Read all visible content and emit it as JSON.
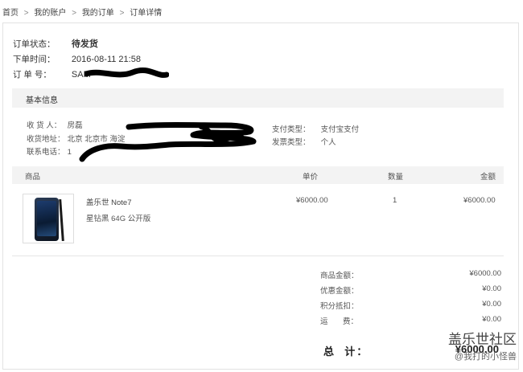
{
  "breadcrumb": [
    "首页",
    "我的账户",
    "我的订单",
    "订单详情"
  ],
  "breadcrumb_sep": ">",
  "order": {
    "status_label": "订单状态：",
    "status_value": "待发货",
    "time_label": "下单时间：",
    "time_value": "2016-08-11 21:58",
    "number_label": "订 单 号：",
    "number_value": "SAM"
  },
  "basic_info": {
    "title": "基本信息",
    "receiver_label": "收 货 人：",
    "receiver_value": "房磊",
    "address_label": "收货地址：",
    "address_value": "北京  北京市  海淀",
    "phone_label": "联系电话：",
    "phone_value": "1",
    "pay_type_label": "支付类型：",
    "pay_type_value": "支付宝支付",
    "invoice_label": "发票类型：",
    "invoice_value": "个人"
  },
  "table": {
    "headers": {
      "product": "商品",
      "price": "单价",
      "qty": "数量",
      "amount": "金额"
    },
    "items": [
      {
        "name": "盖乐世 Note7",
        "spec": "星钻黑   64G   公开版",
        "price": "¥6000.00",
        "qty": "1",
        "amount": "¥6000.00"
      }
    ]
  },
  "summary": [
    {
      "label": "商品金额：",
      "value": "¥6000.00"
    },
    {
      "label": "优惠金额：",
      "value": "¥0.00"
    },
    {
      "label": "积分抵扣：",
      "value": "¥0.00"
    },
    {
      "label": "运       费：",
      "value": "¥0.00"
    }
  ],
  "total": {
    "label": "总  计：",
    "value": "¥6000.00"
  },
  "watermark": {
    "line1": "盖乐世社区",
    "line2": "@我打的小怪兽"
  },
  "colors": {
    "border": "#e2e2e2",
    "section_bg": "#f3f3f3",
    "redaction": "#000000"
  }
}
